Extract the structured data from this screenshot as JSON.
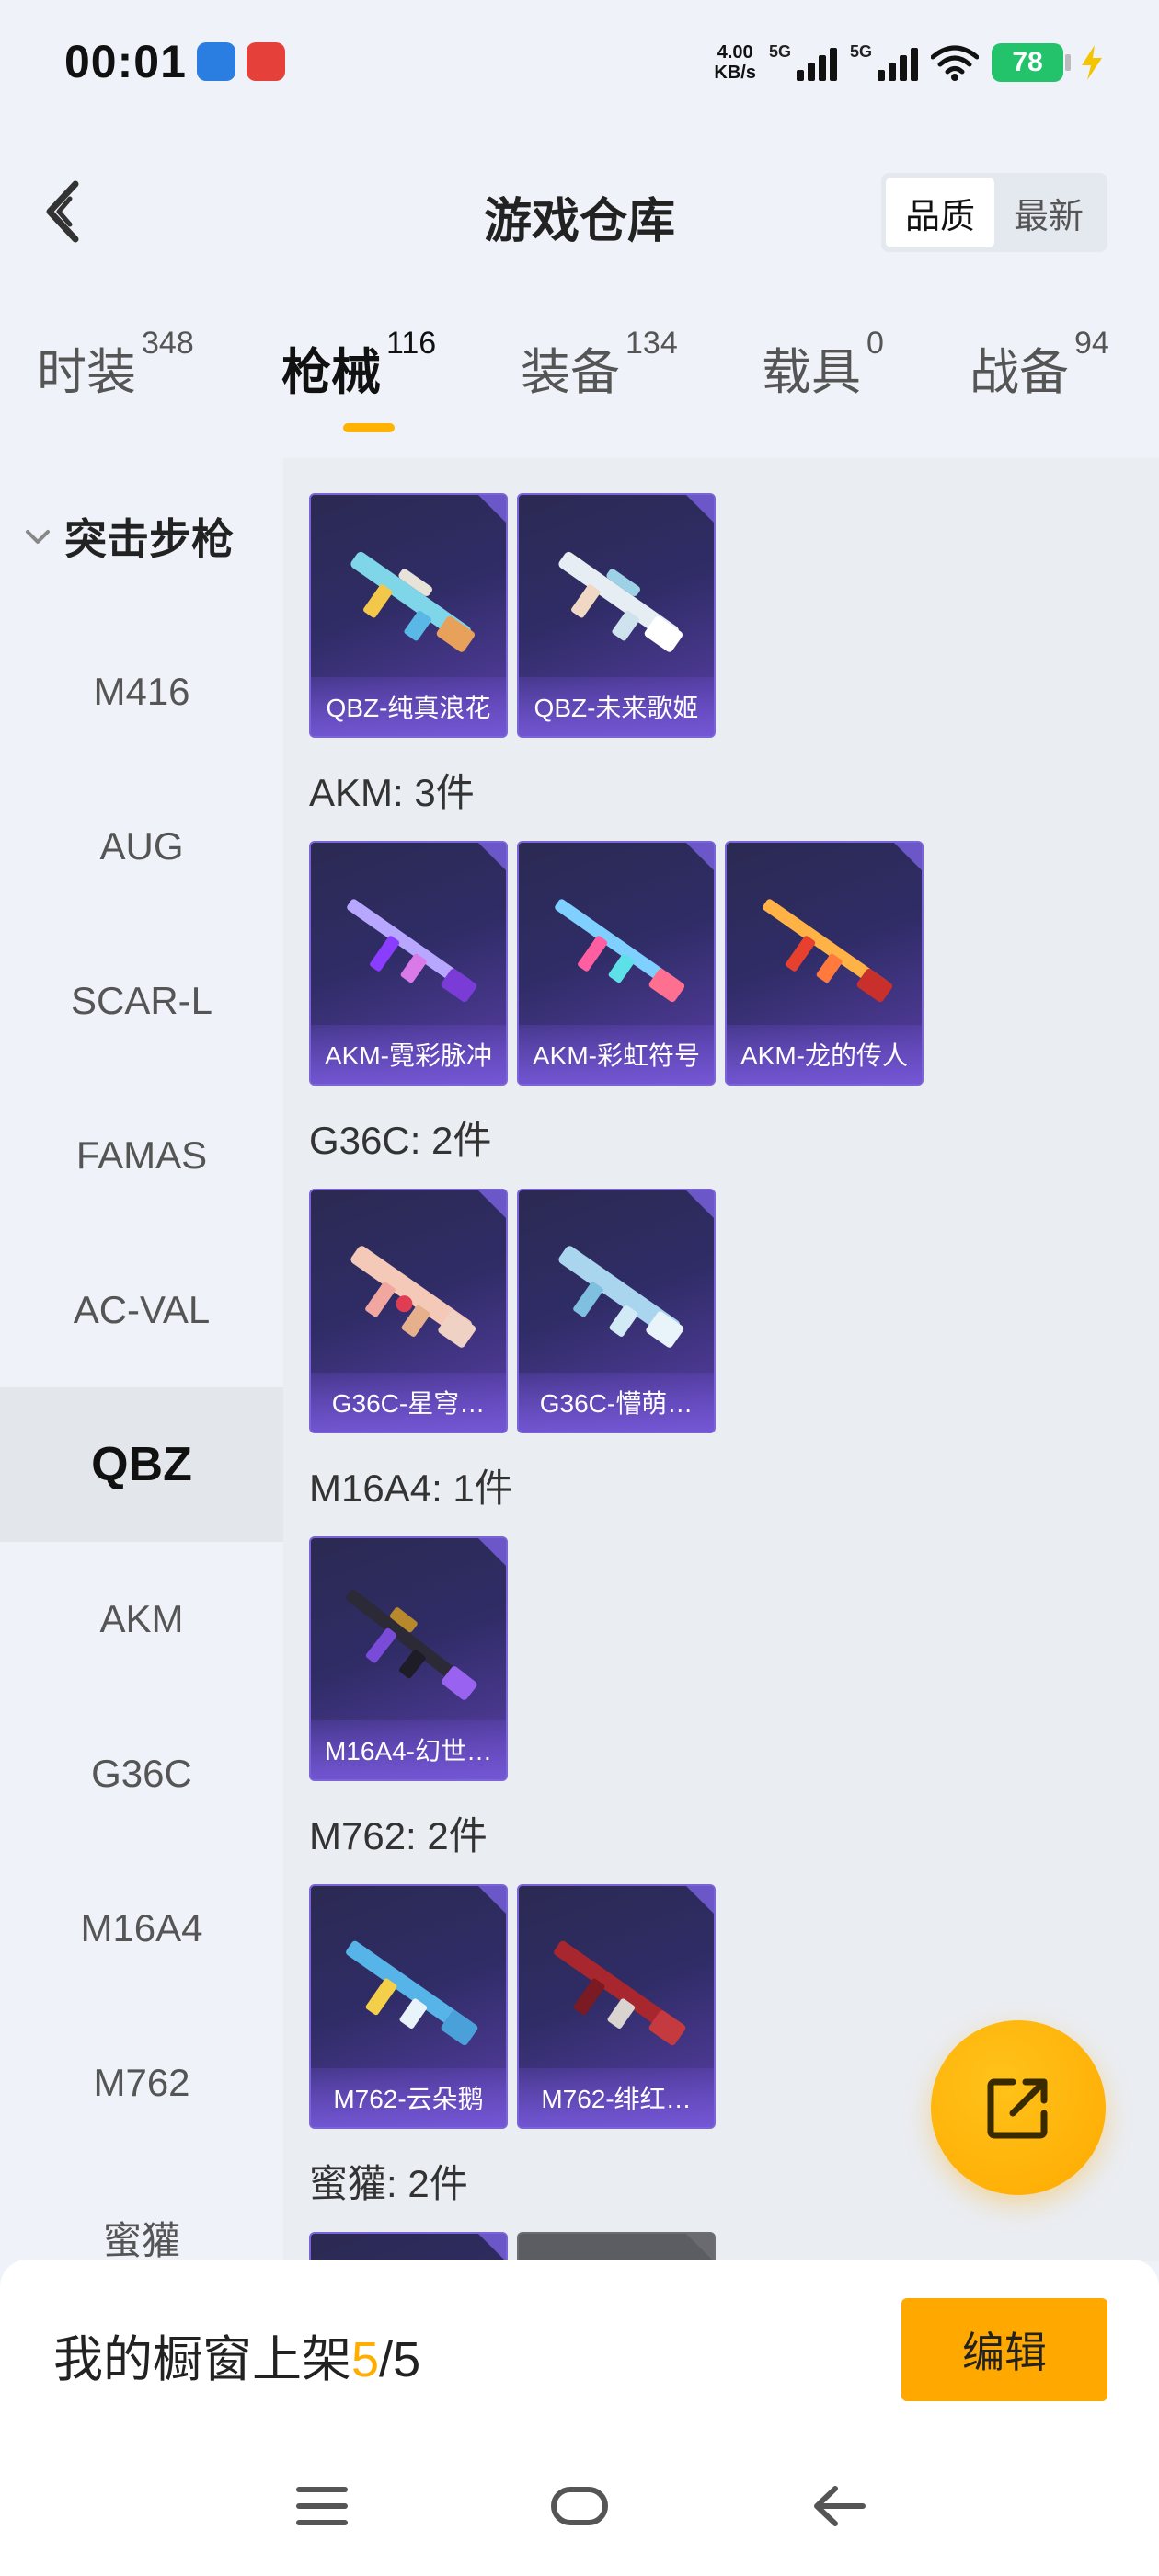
{
  "status_bar": {
    "time": "00:01",
    "net_speed_value": "4.00",
    "net_speed_unit": "KB/s",
    "signal1_label": "5G",
    "signal2_label": "5G",
    "battery": "78"
  },
  "header": {
    "title": "游戏仓库",
    "sort_options": [
      "品质",
      "最新"
    ],
    "sort_selected": "品质"
  },
  "tabs": [
    {
      "label": "时装",
      "count": "348"
    },
    {
      "label": "枪械",
      "count": "116"
    },
    {
      "label": "装备",
      "count": "134"
    },
    {
      "label": "载具",
      "count": "0"
    },
    {
      "label": "战备",
      "count": "94"
    }
  ],
  "sidebar": {
    "group": "突击步枪",
    "items": [
      "M416",
      "AUG",
      "SCAR-L",
      "FAMAS",
      "AC-VAL",
      "QBZ",
      "AKM",
      "G36C",
      "M16A4",
      "M762",
      "蜜獾"
    ],
    "active": "QBZ"
  },
  "sections": [
    {
      "title": "",
      "items": [
        {
          "name": "QBZ-纯真浪花"
        },
        {
          "name": "QBZ-未来歌姬"
        }
      ]
    },
    {
      "title": "AKM: 3件",
      "items": [
        {
          "name": "AKM-霓彩脉冲"
        },
        {
          "name": "AKM-彩虹符号"
        },
        {
          "name": "AKM-龙的传人"
        }
      ]
    },
    {
      "title": "G36C: 2件",
      "items": [
        {
          "name": "G36C-星穹…"
        },
        {
          "name": "G36C-懵萌…"
        }
      ]
    },
    {
      "title": "M16A4: 1件",
      "items": [
        {
          "name": "M16A4-幻世…"
        }
      ]
    },
    {
      "title": "M762: 2件",
      "items": [
        {
          "name": "M762-云朵鹅"
        },
        {
          "name": "M762-绯红…"
        }
      ]
    },
    {
      "title": "蜜獾: 2件",
      "items": []
    }
  ],
  "bottom": {
    "shelf_prefix": "我的橱窗上架",
    "shelf_current": "5",
    "shelf_sep": "/",
    "shelf_total": "5",
    "edit_label": "编辑"
  },
  "colors": {
    "accent": "#ffa800",
    "background": "#eff3f9",
    "content_bg": "#eaedf2",
    "card_border": "#7b64d8"
  }
}
